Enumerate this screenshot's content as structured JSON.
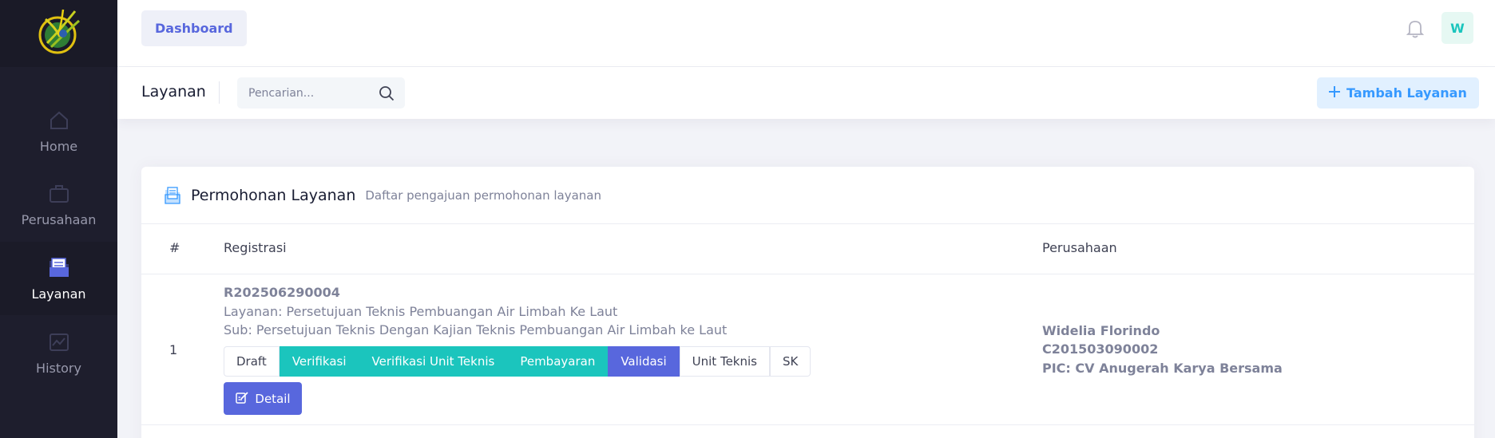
{
  "sidebar": {
    "items": [
      {
        "label": "Home",
        "icon": "home-icon"
      },
      {
        "label": "Perusahaan",
        "icon": "briefcase-icon"
      },
      {
        "label": "Layanan",
        "icon": "folder-icon",
        "active": true
      },
      {
        "label": "History",
        "icon": "chart-icon"
      }
    ]
  },
  "header": {
    "dashboard_label": "Dashboard",
    "avatar_initial": "W"
  },
  "subheader": {
    "title": "Layanan",
    "search_placeholder": "Pencarian...",
    "add_label": "Tambah Layanan"
  },
  "card": {
    "title": "Permohonan Layanan",
    "subtitle": "Daftar pengajuan permohonan layanan",
    "columns": [
      "#",
      "Registrasi",
      "Perusahaan"
    ],
    "rows": [
      {
        "number": "1",
        "registration": "R202506290004",
        "layanan": "Layanan: Persetujuan Teknis Pembuangan Air Limbah Ke Laut",
        "sub": "Sub: Persetujuan Teknis Dengan Kajian Teknis Pembuangan Air Limbah ke Laut",
        "steps": [
          "Draft",
          "Verifikasi",
          "Verifikasi Unit Teknis",
          "Pembayaran",
          "Validasi",
          "Unit Teknis",
          "SK"
        ],
        "detail_label": "Detail",
        "company_name": "Widelia Florindo",
        "company_code": "C201503090002",
        "pic": "PIC: CV Anugerah Karya Bersama"
      }
    ]
  },
  "colors": {
    "sidebar_bg": "#1e1e2d",
    "accent": "#5867dd",
    "done_step": "#1bc5bd",
    "primary_light": "#3699ff"
  }
}
